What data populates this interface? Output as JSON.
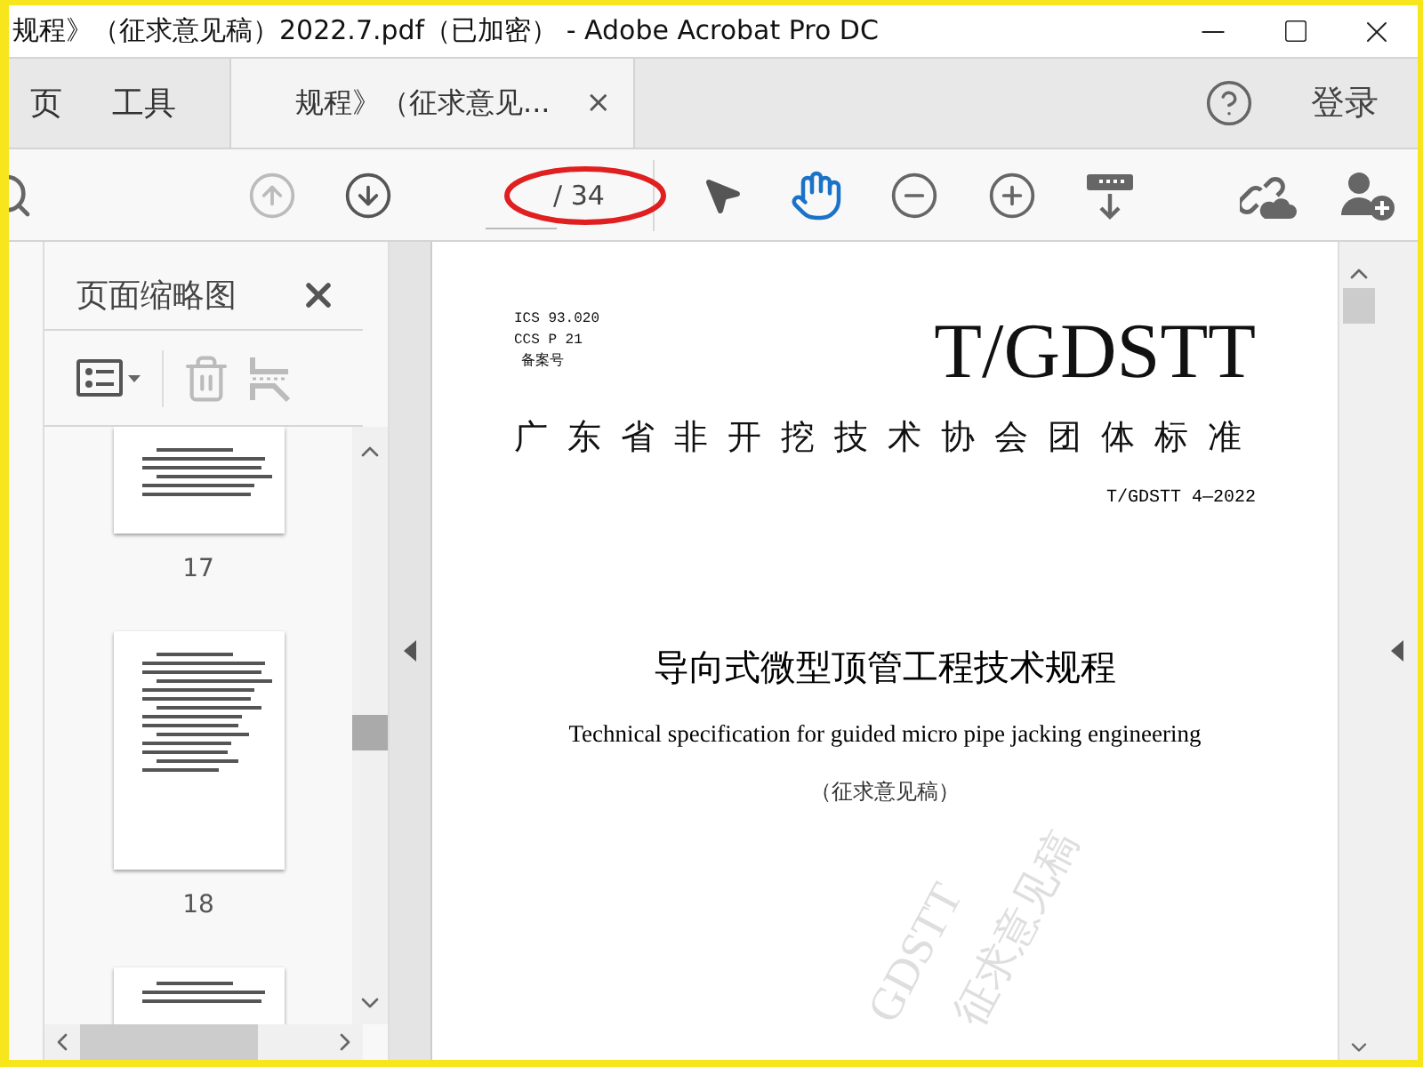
{
  "window": {
    "title": "规程》（征求意见稿）2022.7.pdf（已加密） - Adobe Acrobat Pro DC"
  },
  "tabs": [
    {
      "label": "页",
      "selected": false
    },
    {
      "label": "工具",
      "selected": false
    },
    {
      "label": "规程》（征求意见...",
      "selected": true,
      "close": "×"
    }
  ],
  "account": {
    "sign_in": "登录"
  },
  "toolbar": {
    "nav": [
      {
        "kind": "up",
        "disabled": true
      },
      {
        "kind": "down",
        "disabled": false
      }
    ],
    "page_total": "/ 34",
    "modes": [
      {
        "kind": "pointer",
        "selected": false
      },
      {
        "kind": "hand",
        "selected": true
      }
    ],
    "zoom": [
      {
        "kind": "minus"
      },
      {
        "kind": "plus"
      },
      {
        "kind": "keyboard"
      }
    ]
  },
  "thumbnails_panel": {
    "title": "页面缩略图",
    "pages": [
      {
        "kind": "cut-top",
        "label": "17"
      },
      {
        "kind": "full",
        "label": "18"
      },
      {
        "kind": "cut-bottom"
      }
    ]
  },
  "document": {
    "codes": [
      "ICS 93.020",
      "CCS P 21",
      "备案号"
    ],
    "logo": "T/GDSTT",
    "association": "广东省非开挖技术协会团体标准",
    "standard_no": "T/GDSTT 4—2022",
    "title": "导向式微型顶管工程技术规程",
    "title_en": "Technical specification for guided micro pipe jacking engineering",
    "status": "（征求意见稿）",
    "watermark": [
      "GDSTT",
      "征求意见稿"
    ]
  }
}
